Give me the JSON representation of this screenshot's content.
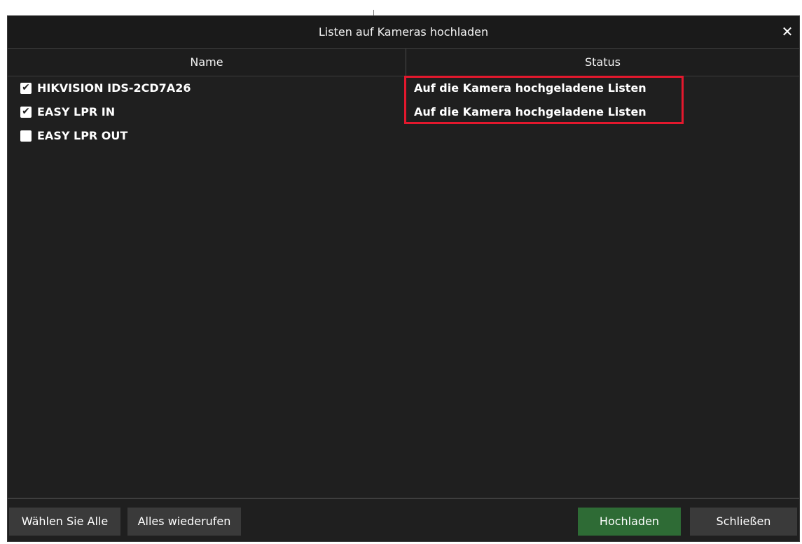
{
  "dialog": {
    "title": "Listen auf Kameras hochladen",
    "close_glyph": "✕"
  },
  "table": {
    "columns": [
      "Name",
      "Status"
    ],
    "rows": [
      {
        "name": "HIKVISION IDS-2CD7A26",
        "checked": true,
        "status": "Auf die Kamera hochgeladene Listen"
      },
      {
        "name": "EASY LPR IN",
        "checked": true,
        "status": "Auf die Kamera hochgeladene Listen"
      },
      {
        "name": "EASY LPR OUT",
        "checked": false,
        "status": ""
      }
    ]
  },
  "footer": {
    "select_all_label": "Wählen Sie Alle",
    "revoke_all_label": "Alles wiederufen",
    "upload_label": "Hochladen",
    "close_label": "Schließen"
  },
  "colors": {
    "dialog_bg": "#1f1f1f",
    "highlight_red": "#e3182d",
    "upload_green": "#2e6b35",
    "button_gray": "#3a3a3a"
  },
  "icons": {
    "checkbox_checked": "check-icon",
    "close": "close-icon"
  }
}
